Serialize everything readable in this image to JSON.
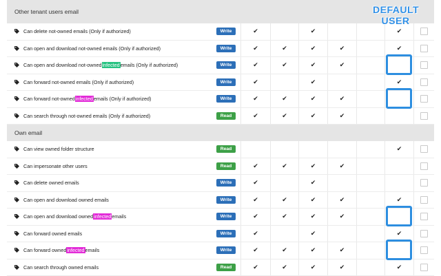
{
  "overlay": {
    "line1": "DEFAULT",
    "line2": "USER"
  },
  "sections": [
    {
      "title": "Other tenant users email",
      "rows": [
        {
          "parts": [
            {
              "t": "Can delete not-owned emails (Only if authorized)"
            }
          ],
          "access": "Write",
          "checks": [
            true,
            false,
            true,
            false,
            false,
            true
          ],
          "box": false
        },
        {
          "parts": [
            {
              "t": "Can open and download not-owned emails (Only if authorized)"
            }
          ],
          "access": "Write",
          "checks": [
            true,
            true,
            true,
            true,
            false,
            true
          ],
          "box": false
        },
        {
          "parts": [
            {
              "t": "Can open and download not-owned "
            },
            {
              "t": "infected",
              "hl": "green"
            },
            {
              "t": " emails (Only if authorized)"
            }
          ],
          "access": "Write",
          "checks": [
            true,
            true,
            true,
            true,
            false,
            false
          ],
          "box": true
        },
        {
          "parts": [
            {
              "t": "Can forward not-owned emails (Only if authorized)"
            }
          ],
          "access": "Write",
          "checks": [
            true,
            false,
            true,
            false,
            false,
            true
          ],
          "box": false
        },
        {
          "parts": [
            {
              "t": "Can forward not-owned "
            },
            {
              "t": "infected",
              "hl": "magenta"
            },
            {
              "t": " emails (Only if authorized)"
            }
          ],
          "access": "Write",
          "checks": [
            true,
            true,
            true,
            true,
            false,
            false
          ],
          "box": true
        },
        {
          "parts": [
            {
              "t": "Can search through not-owned emails (Only if authorized)"
            }
          ],
          "access": "Read",
          "checks": [
            true,
            true,
            true,
            true,
            false,
            false
          ],
          "box": false
        }
      ]
    },
    {
      "title": "Own email",
      "rows": [
        {
          "parts": [
            {
              "t": "Can view owned folder structure"
            }
          ],
          "access": "Read",
          "checks": [
            false,
            false,
            false,
            false,
            false,
            true
          ],
          "box": false
        },
        {
          "parts": [
            {
              "t": "Can impersonate other users"
            }
          ],
          "access": "Read",
          "checks": [
            true,
            true,
            true,
            true,
            false,
            false
          ],
          "box": false
        },
        {
          "parts": [
            {
              "t": "Can delete owned emails"
            }
          ],
          "access": "Write",
          "checks": [
            true,
            false,
            true,
            false,
            false,
            false
          ],
          "box": false
        },
        {
          "parts": [
            {
              "t": "Can open and download owned emails"
            }
          ],
          "access": "Write",
          "checks": [
            true,
            true,
            true,
            true,
            false,
            true
          ],
          "box": false
        },
        {
          "parts": [
            {
              "t": "Can open and download owned "
            },
            {
              "t": "infected",
              "hl": "magenta"
            },
            {
              "t": " emails"
            }
          ],
          "access": "Write",
          "checks": [
            true,
            true,
            true,
            true,
            false,
            false
          ],
          "box": true
        },
        {
          "parts": [
            {
              "t": "Can forward owned emails"
            }
          ],
          "access": "Write",
          "checks": [
            true,
            false,
            true,
            false,
            false,
            true
          ],
          "box": false
        },
        {
          "parts": [
            {
              "t": "Can forward owned "
            },
            {
              "t": "infected",
              "hl": "magenta"
            },
            {
              "t": " emails"
            }
          ],
          "access": "Write",
          "checks": [
            true,
            true,
            true,
            true,
            false,
            false
          ],
          "box": true
        },
        {
          "parts": [
            {
              "t": "Can search through owned emails"
            }
          ],
          "access": "Read",
          "checks": [
            true,
            true,
            true,
            true,
            false,
            true
          ],
          "box": false
        }
      ]
    }
  ],
  "colors": {
    "write": "#2c6fb8",
    "read": "#3da047",
    "highlight_box": "#2d8ee0",
    "infected_green": "#26c281",
    "infected_magenta": "#e22bd8"
  },
  "icons": {
    "row": "tag-icon",
    "check": "checkmark-icon"
  }
}
